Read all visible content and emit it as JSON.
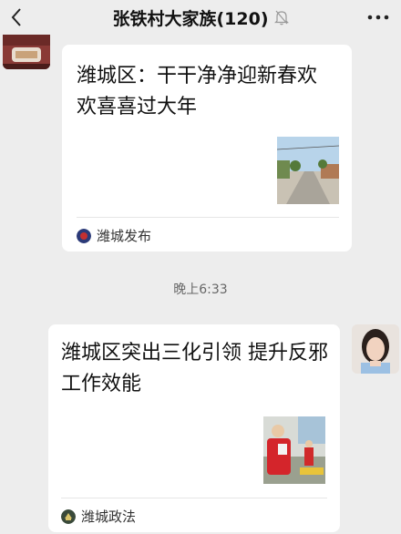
{
  "header": {
    "title": "张铁村大家族(120)",
    "back_icon": "chevron-left-icon",
    "mute_icon": "bell-off-icon",
    "more_icon": "more-dots-icon"
  },
  "messages": [
    {
      "title": "潍城区：干干净净迎新春欢欢喜喜过大年",
      "source": "潍城发布"
    },
    {
      "timestamp": "晚上6:33",
      "title": "潍城区突出三化引领  提升反邪工作效能",
      "source": "潍城政法"
    }
  ],
  "colors": {
    "background": "#ededed",
    "card": "#ffffff"
  }
}
